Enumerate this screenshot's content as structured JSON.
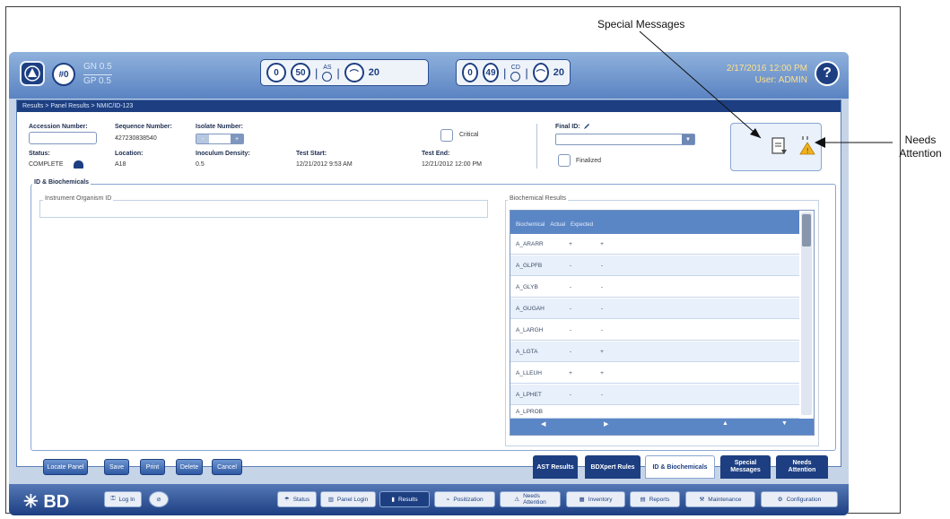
{
  "annotations": {
    "special_messages": "Special Messages",
    "needs_attention_l1": "Needs",
    "needs_attention_l2": "Attention"
  },
  "topbar": {
    "count_badge": "#0",
    "gn_label": "GN 0.5",
    "gp_label": "GP 0.5",
    "counter1": {
      "left_value": "0",
      "mid_value": "50",
      "stack_label": "AS",
      "right_value": "20"
    },
    "counter2": {
      "left_value": "0",
      "mid_value": "49",
      "stack_label": "CD",
      "right_value": "20"
    },
    "datetime": "2/17/2016 12:00 PM",
    "user": "User: ADMIN",
    "help": "?"
  },
  "breadcrumb": "Results  >  Panel Results  >  NMIC/ID-123",
  "form": {
    "accession_label": "Accession Number:",
    "sequence_label": "Sequence Number:",
    "sequence_value": "427230838540",
    "isolate_label": "Isolate Number:",
    "critical_label": "Critical",
    "final_id_label": "Final ID:",
    "status_label": "Status:",
    "status_value": "COMPLETE",
    "location_label": "Location:",
    "location_value": "A18",
    "inoculum_label": "Inoculum Density:",
    "inoculum_value": "0.5",
    "test_start_label": "Test Start:",
    "test_start_value": "12/21/2012 9:53 AM",
    "test_end_label": "Test End:",
    "test_end_value": "12/21/2012 12:00 PM",
    "finalized_label": "Finalized"
  },
  "section": {
    "legend": "ID & Biochemicals",
    "instrument_label": "Instrument Organism ID",
    "biochem_label": "Biochemical Results"
  },
  "biochem": {
    "headers": [
      "Biochemical",
      "Actual",
      "Expected"
    ],
    "rows": [
      {
        "name": "A_ARARR",
        "actual": "+",
        "expected": "+"
      },
      {
        "name": "A_GLPFB",
        "actual": "-",
        "expected": "-"
      },
      {
        "name": "A_GLYB",
        "actual": "-",
        "expected": "-"
      },
      {
        "name": "A_GUGAH",
        "actual": "-",
        "expected": "-"
      },
      {
        "name": "A_LARGH",
        "actual": "-",
        "expected": "-"
      },
      {
        "name": "A_LGTA",
        "actual": "-",
        "expected": "+"
      },
      {
        "name": "A_LLEUH",
        "actual": "+",
        "expected": "+"
      },
      {
        "name": "A_LPHET",
        "actual": "-",
        "expected": "-"
      },
      {
        "name": "A_LPROB",
        "actual": "",
        "expected": ""
      }
    ]
  },
  "actions": {
    "locate": "Locate Panel",
    "save": "Save",
    "print": "Print",
    "delete": "Delete",
    "cancel": "Cancel"
  },
  "tabs": {
    "ast": "AST Results",
    "bdxpert": "BDXpert Rules",
    "id_bio": "ID & Biochemicals",
    "special_l1": "Special",
    "special_l2": "Messages",
    "needs_l1": "Needs",
    "needs_l2": "Attention"
  },
  "footer": {
    "brand": "BD",
    "login": "Log In",
    "status": "Status",
    "panel_login": "Panel Login",
    "results": "Results",
    "panel_loc": "Positization",
    "needs_l1": "Needs",
    "needs_l2": "Attention",
    "inventory": "Inventory",
    "reports": "Reports",
    "maintenance": "Maintenance",
    "configuration": "Configuration"
  },
  "colors": {
    "brand_dark": "#1d3f82",
    "accent": "#5b86c6",
    "warning": "#f2b21b"
  }
}
